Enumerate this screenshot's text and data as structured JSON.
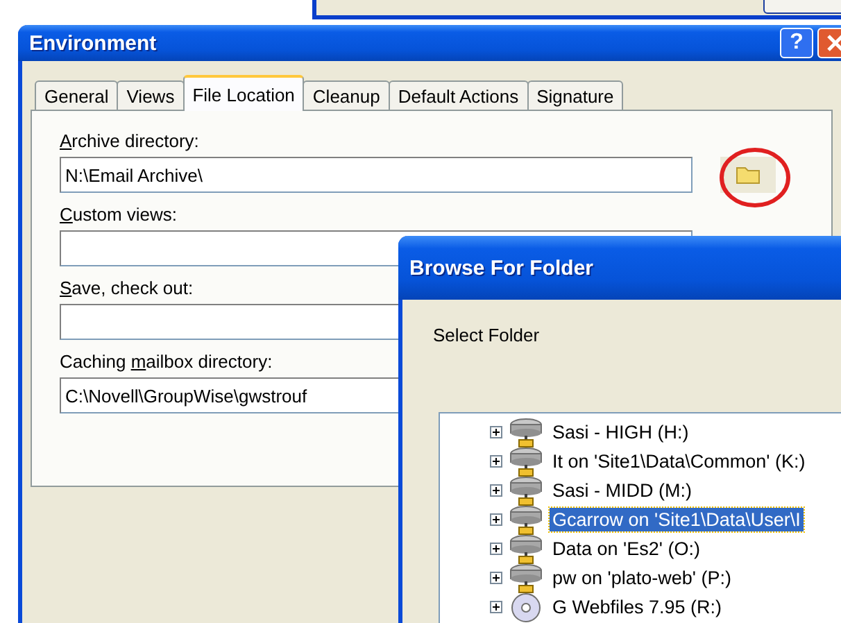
{
  "environment_window": {
    "title": "Environment",
    "help_button": "?",
    "tabs": [
      {
        "label": "General",
        "selected": false
      },
      {
        "label": "Views",
        "selected": false
      },
      {
        "label": "File Location",
        "selected": true
      },
      {
        "label": "Cleanup",
        "selected": false
      },
      {
        "label": "Default Actions",
        "selected": false
      },
      {
        "label": "Signature",
        "selected": false
      }
    ],
    "fields": [
      {
        "access_key": "A",
        "label_after": "rchive directory:",
        "value": "N:\\Email Archive\\",
        "browse_button": true
      },
      {
        "access_key": "C",
        "label_after": "ustom views:"
      },
      {
        "access_key": "S",
        "label_after": "ave, check out:"
      },
      {
        "label_before": "Caching ",
        "access_key": "m",
        "label_after": "ailbox directory:",
        "value": "C:\\Novell\\GroupWise\\gwstrouf"
      }
    ]
  },
  "browse_dialog": {
    "title": "Browse For Folder",
    "prompt": "Select Folder",
    "tree": [
      {
        "kind": "network-drive",
        "label": "Sasi - HIGH (H:)",
        "selected": false
      },
      {
        "kind": "network-drive",
        "label": "It on 'Site1\\Data\\Common' (K:)",
        "selected": false
      },
      {
        "kind": "network-drive",
        "label": "Sasi - MIDD (M:)",
        "selected": false
      },
      {
        "kind": "network-drive",
        "label": "Gcarrow on 'Site1\\Data\\User\\I",
        "selected": true
      },
      {
        "kind": "network-drive",
        "label": "Data on 'Es2' (O:)",
        "selected": false
      },
      {
        "kind": "network-drive",
        "label": "pw on 'plato-web' (P:)",
        "selected": false
      },
      {
        "kind": "cd-drive",
        "label": "G Webfiles 7.95 (R:)",
        "selected": false
      }
    ]
  }
}
